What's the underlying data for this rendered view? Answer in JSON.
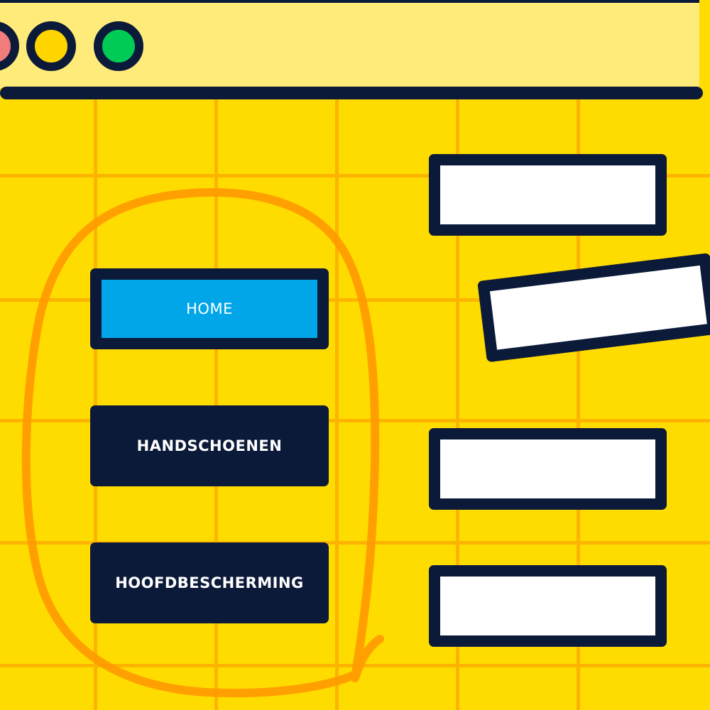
{
  "window": {
    "controls": [
      {
        "name": "close",
        "color": "#F07C7C"
      },
      {
        "name": "minimize",
        "color": "#FFD500"
      },
      {
        "name": "maximize",
        "color": "#00CC55"
      }
    ]
  },
  "nav": {
    "items": [
      {
        "label": "HOME",
        "active": true
      },
      {
        "label": "HANDSCHOENEN",
        "active": false
      },
      {
        "label": "HOOFDBESCHERMING",
        "active": false
      }
    ]
  },
  "colors": {
    "background": "#FFDC00",
    "grid": "#FDB400",
    "outline": "#0C1A3A",
    "active": "#00A6E8",
    "scribble": "#FF9A00",
    "shadow": "#E87A00"
  }
}
